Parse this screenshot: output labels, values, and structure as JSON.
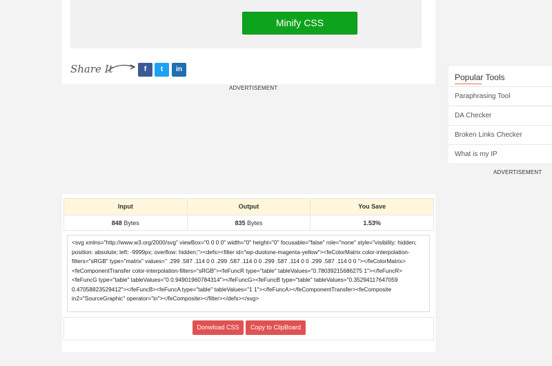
{
  "top": {
    "minify_label": "Minify CSS",
    "share_label": "Share It"
  },
  "share": {
    "facebook": "f",
    "twitter": "t",
    "linkedin": "in"
  },
  "ads": {
    "label_1": "ADVERTISEMENT",
    "label_2": "ADVERTISEMENT"
  },
  "popular": {
    "title": "Popular Tools",
    "items": [
      "Paraphrasing Tool",
      "DA Checker",
      "Broken Links Checker",
      "What is my IP"
    ]
  },
  "stats": {
    "headers": [
      "Input",
      "Output",
      "You Save"
    ],
    "input_value": "848",
    "input_unit": "Bytes",
    "output_value": "835",
    "output_unit": "Bytes",
    "save_value": "1.53%"
  },
  "output_code": "<svg xmlns=\"http://www.w3.org/2000/svg\" viewBox=\"0 0 0 0\" width=\"0\" height=\"0\" focusable=\"false\" role=\"none\" style=\"visibility: hidden; position: absolute; left: -9999px; overflow: hidden;\"><defs><filter id=\"wp-duotone-magenta-yellow\"><feColorMatrix color-interpolation-filters=\"sRGB\" type=\"matrix\" values=\" .299 .587 .114 0 0 .299 .587 .114 0 0 .299 .587 .114 0 0 .299 .587 .114 0 0 \"></feColorMatrix><feComponentTransfer color-interpolation-filters=\"sRGB\"><feFuncR type=\"table\" tableValues=\"0.78039215686275 1\"></feFuncR><feFuncG type=\"table\" tableValues=\"0 0.94901960784314\"></feFuncG><feFuncB type=\"table\" tableValues=\"0.35294117647059 0.47058823529412\"></feFuncB><feFuncA type=\"table\" tableValues=\"1 1\"></feFuncA></feComponentTransfer><feComposite in2=\"SourceGraphic\" operator=\"in\"></feComposite></filter></defs></svg>",
  "actions": {
    "download": "Donwload CSS",
    "copy": "Copy to ClipBoard"
  }
}
